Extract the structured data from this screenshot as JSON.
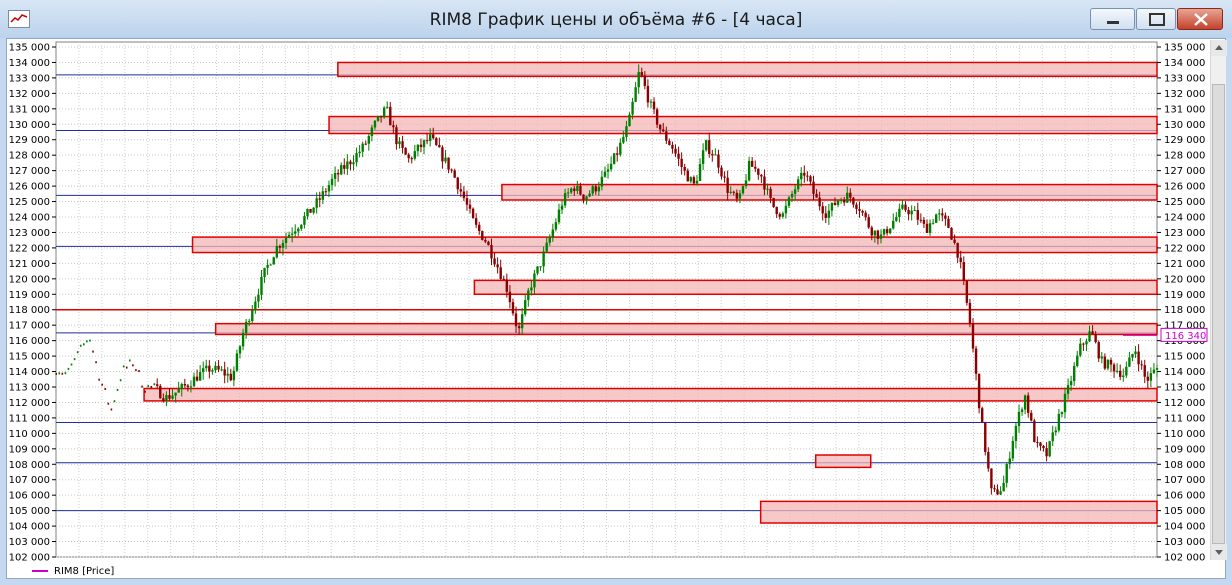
{
  "window": {
    "title": "RIM8 График цены и объёма #6 - [4 часа]"
  },
  "legend": {
    "label": "RIM8 [Price]",
    "color": "#cc00cc"
  },
  "chart_data": {
    "type": "candlestick",
    "title": "",
    "xlabel": "",
    "ylabel": "",
    "ylim": [
      102000,
      135000
    ],
    "y_ticks": [
      "102 000",
      "103 000",
      "104 000",
      "105 000",
      "106 000",
      "107 000",
      "108 000",
      "109 000",
      "110 000",
      "111 000",
      "112 000",
      "113 000",
      "114 000",
      "115 000",
      "116 000",
      "117 000",
      "118 000",
      "119 000",
      "120 000",
      "121 000",
      "122 000",
      "123 000",
      "124 000",
      "125 000",
      "126 000",
      "127 000",
      "128 000",
      "129 000",
      "130 000",
      "131 000",
      "132 000",
      "133 000",
      "134 000",
      "135 000"
    ],
    "grid": true,
    "current_price_label": "116 340",
    "current_price": 116340,
    "colors": {
      "up": "#008000",
      "down": "#8b0000",
      "zone_fill": "#f4b6b6",
      "zone_stroke": "#e00000",
      "blue_line": "#1f2f9f"
    },
    "horizontal_levels_blue": [
      133200,
      129600,
      125400,
      122100,
      116500,
      110700,
      108100,
      105000
    ],
    "horizontal_levels_red": [
      118000
    ],
    "zones": [
      {
        "x_start": 0.256,
        "low": 133100,
        "high": 134000
      },
      {
        "x_start": 0.248,
        "low": 129400,
        "high": 130500
      },
      {
        "x_start": 0.405,
        "low": 125100,
        "high": 126100
      },
      {
        "x_start": 0.124,
        "low": 121700,
        "high": 122700
      },
      {
        "x_start": 0.38,
        "low": 119000,
        "high": 119900
      },
      {
        "x_start": 0.145,
        "low": 116400,
        "high": 117100
      },
      {
        "x_start": 0.08,
        "low": 112100,
        "high": 112900
      },
      {
        "x_start": 0.69,
        "x_end": 0.74,
        "low": 107800,
        "high": 108600
      },
      {
        "x_start": 0.64,
        "low": 104200,
        "high": 105600
      }
    ],
    "price_path": [
      [
        0.0,
        114200
      ],
      [
        0.01,
        113800
      ],
      [
        0.02,
        115100
      ],
      [
        0.03,
        116300
      ],
      [
        0.04,
        113500
      ],
      [
        0.05,
        111500
      ],
      [
        0.06,
        114000
      ],
      [
        0.07,
        114600
      ],
      [
        0.08,
        113000
      ],
      [
        0.09,
        112900
      ],
      [
        0.1,
        112300
      ],
      [
        0.11,
        112700
      ],
      [
        0.12,
        113200
      ],
      [
        0.13,
        113800
      ],
      [
        0.14,
        114200
      ],
      [
        0.15,
        114000
      ],
      [
        0.16,
        113600
      ],
      [
        0.17,
        116500
      ],
      [
        0.18,
        118500
      ],
      [
        0.19,
        120500
      ],
      [
        0.2,
        122000
      ],
      [
        0.21,
        122800
      ],
      [
        0.22,
        123500
      ],
      [
        0.23,
        124300
      ],
      [
        0.24,
        125200
      ],
      [
        0.25,
        126300
      ],
      [
        0.26,
        127100
      ],
      [
        0.27,
        127800
      ],
      [
        0.28,
        128600
      ],
      [
        0.29,
        130000
      ],
      [
        0.3,
        131000
      ],
      [
        0.31,
        128800
      ],
      [
        0.32,
        127700
      ],
      [
        0.33,
        128500
      ],
      [
        0.34,
        129100
      ],
      [
        0.35,
        128000
      ],
      [
        0.36,
        126900
      ],
      [
        0.37,
        125300
      ],
      [
        0.38,
        123500
      ],
      [
        0.39,
        122500
      ],
      [
        0.4,
        121000
      ],
      [
        0.41,
        119300
      ],
      [
        0.42,
        116500
      ],
      [
        0.43,
        119400
      ],
      [
        0.44,
        121000
      ],
      [
        0.45,
        122900
      ],
      [
        0.46,
        125000
      ],
      [
        0.47,
        126000
      ],
      [
        0.48,
        125300
      ],
      [
        0.49,
        125900
      ],
      [
        0.5,
        126800
      ],
      [
        0.51,
        128200
      ],
      [
        0.52,
        130000
      ],
      [
        0.53,
        133500
      ],
      [
        0.54,
        131200
      ],
      [
        0.55,
        129500
      ],
      [
        0.56,
        128500
      ],
      [
        0.57,
        127000
      ],
      [
        0.58,
        126000
      ],
      [
        0.59,
        128700
      ],
      [
        0.6,
        127800
      ],
      [
        0.61,
        125800
      ],
      [
        0.62,
        124900
      ],
      [
        0.63,
        127400
      ],
      [
        0.64,
        126800
      ],
      [
        0.65,
        124800
      ],
      [
        0.66,
        124100
      ],
      [
        0.67,
        125700
      ],
      [
        0.68,
        126900
      ],
      [
        0.69,
        125200
      ],
      [
        0.7,
        124200
      ],
      [
        0.71,
        125100
      ],
      [
        0.72,
        125400
      ],
      [
        0.73,
        124600
      ],
      [
        0.74,
        123200
      ],
      [
        0.75,
        122700
      ],
      [
        0.76,
        123700
      ],
      [
        0.77,
        124600
      ],
      [
        0.78,
        124200
      ],
      [
        0.79,
        123200
      ],
      [
        0.8,
        124200
      ],
      [
        0.81,
        123500
      ],
      [
        0.82,
        121500
      ],
      [
        0.83,
        117200
      ],
      [
        0.84,
        111000
      ],
      [
        0.85,
        106000
      ],
      [
        0.86,
        106500
      ],
      [
        0.87,
        110000
      ],
      [
        0.88,
        112500
      ],
      [
        0.89,
        109200
      ],
      [
        0.9,
        108600
      ],
      [
        0.91,
        110900
      ],
      [
        0.92,
        113000
      ],
      [
        0.93,
        115500
      ],
      [
        0.94,
        116600
      ],
      [
        0.95,
        114600
      ],
      [
        0.96,
        114300
      ],
      [
        0.97,
        113800
      ],
      [
        0.98,
        115500
      ],
      [
        0.99,
        113400
      ],
      [
        1.0,
        114200
      ]
    ]
  }
}
